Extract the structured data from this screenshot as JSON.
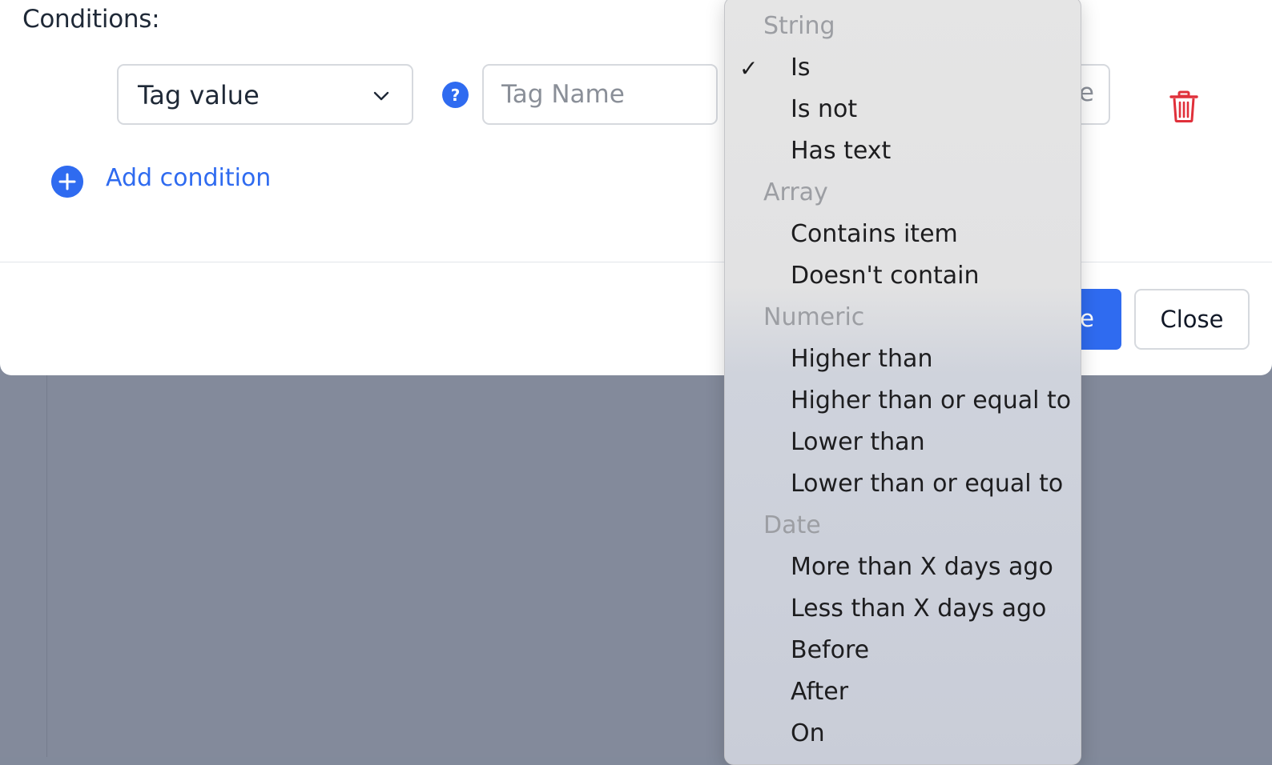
{
  "modal": {
    "conditions_title": "Conditions:",
    "condition_row": {
      "field_select_value": "Tag value",
      "tag_name_placeholder": "Tag Name",
      "tag_value_placeholder_visible": "e"
    },
    "add_condition_label": "Add condition",
    "footer": {
      "primary_button_visible_label": "e",
      "close_button_label": "Close"
    }
  },
  "dropdown": {
    "groups": {
      "string": "String",
      "array": "Array",
      "numeric": "Numeric",
      "date": "Date"
    },
    "checkmark": "✓",
    "options": {
      "is": "Is",
      "is_not": "Is not",
      "has_text": "Has text",
      "contains_item": "Contains item",
      "doesnt_contain": "Doesn't contain",
      "higher_than": "Higher than",
      "higher_than_or_equal": "Higher than or equal to",
      "lower_than": "Lower than",
      "lower_than_or_equal": "Lower than or equal to",
      "more_than_x_days_ago": "More than X days ago",
      "less_than_x_days_ago": "Less than X days ago",
      "before": "Before",
      "after": "After",
      "on": "On"
    },
    "selected": "Is"
  },
  "colors": {
    "accent": "#2f6bf0",
    "danger": "#e0303a",
    "backdrop": "#838a9b"
  },
  "icons": {
    "help": "question-circle-icon",
    "add": "plus-circle-icon",
    "delete": "trash-icon",
    "chevron": "chevron-down-icon",
    "check": "checkmark-icon"
  }
}
